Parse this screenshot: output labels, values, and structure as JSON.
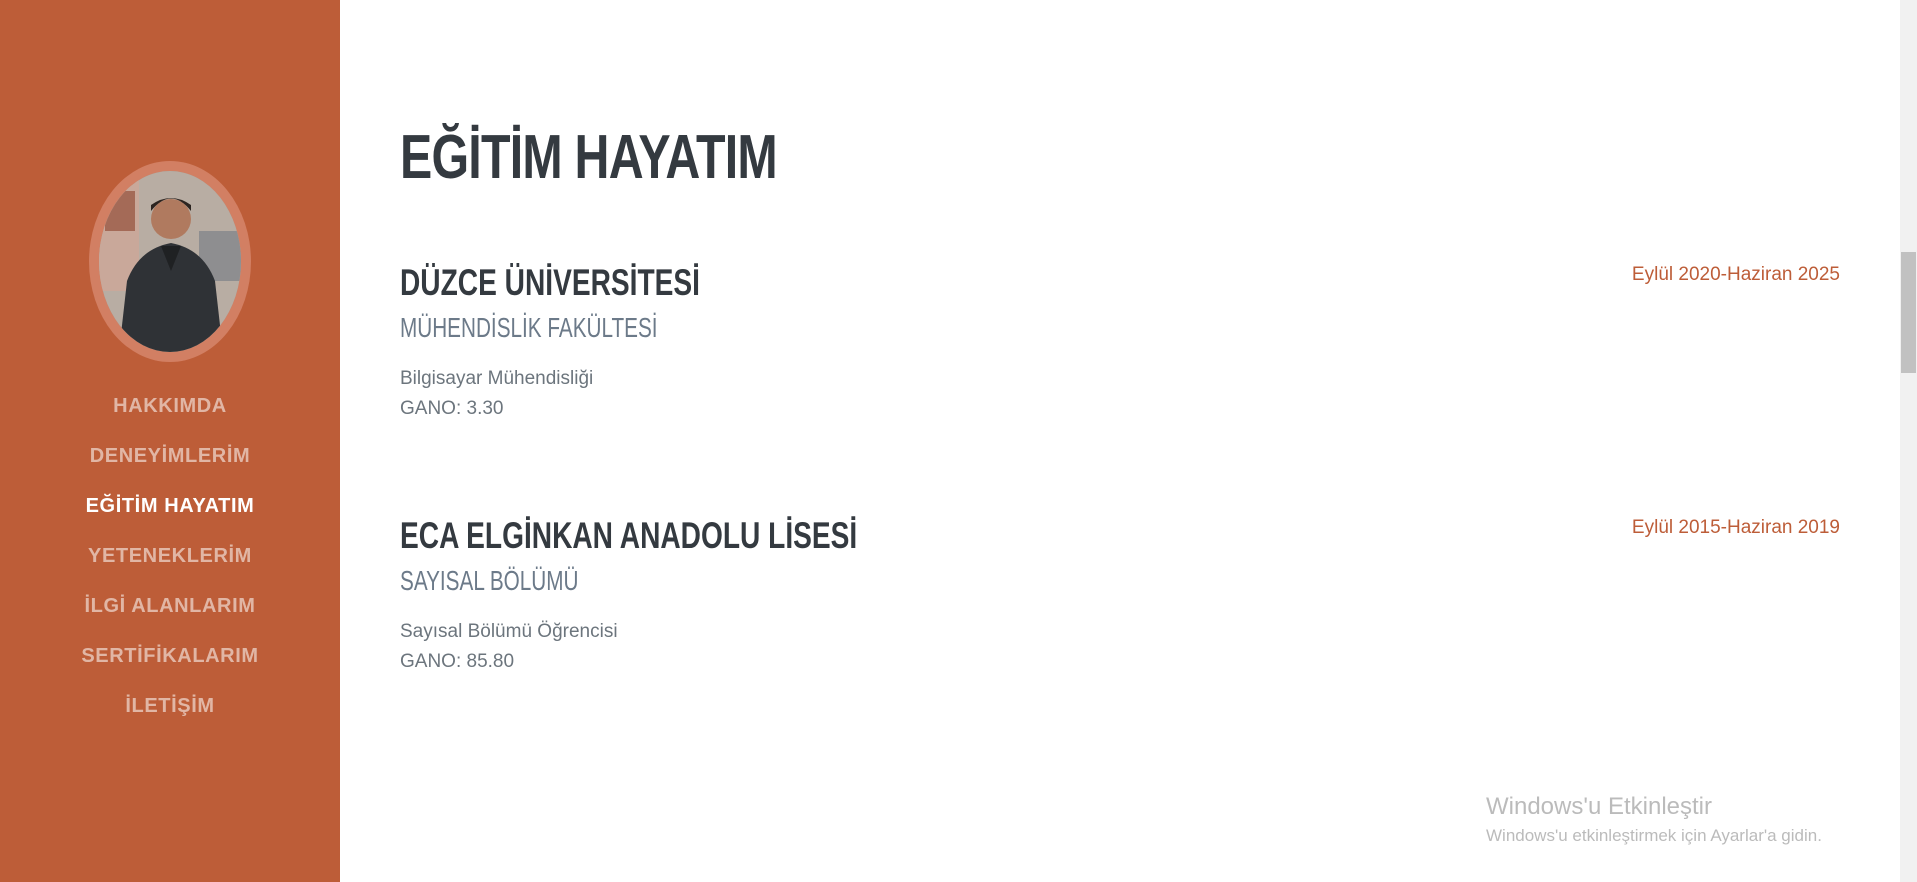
{
  "sidebar": {
    "nav": [
      {
        "label": "HAKKIMDA",
        "active": false
      },
      {
        "label": "DENEYİMLERİM",
        "active": false
      },
      {
        "label": "EĞİTİM HAYATIM",
        "active": true
      },
      {
        "label": "YETENEKLERİM",
        "active": false
      },
      {
        "label": "İLGİ ALANLARIM",
        "active": false
      },
      {
        "label": "SERTİFİKALARIM",
        "active": false
      },
      {
        "label": "İLETİŞİM",
        "active": false
      }
    ]
  },
  "main": {
    "title": "EĞİTİM HAYATIM",
    "education": [
      {
        "school": "DÜZCE ÜNİVERSİTESİ",
        "faculty": "MÜHENDİSLİK FAKÜLTESİ",
        "lines": [
          "Bilgisayar Mühendisliği",
          "GANO: 3.30"
        ],
        "date": "Eylül 2020-Haziran 2025"
      },
      {
        "school": "ECA ELGİNKAN ANADOLU LİSESİ",
        "faculty": "SAYISAL BÖLÜMÜ",
        "lines": [
          "Sayısal Bölümü Öğrencisi",
          "GANO: 85.80"
        ],
        "date": "Eylül 2015-Haziran 2019"
      }
    ]
  },
  "watermark": {
    "title": "Windows'u Etkinleştir",
    "subtitle": "Windows'u etkinleştirmek için Ayarlar'a gidin."
  },
  "colors": {
    "primary": "#bd5d38",
    "heading": "#343a40",
    "muted": "#6c757d"
  }
}
